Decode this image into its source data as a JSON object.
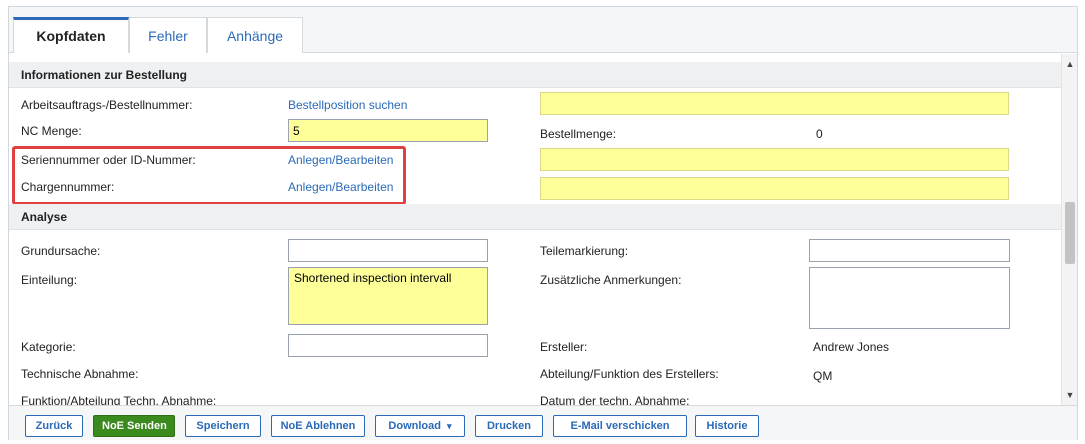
{
  "tabs": [
    {
      "label": "Kopfdaten",
      "active": true
    },
    {
      "label": "Fehler"
    },
    {
      "label": "Anhänge"
    }
  ],
  "sections": {
    "order_info": "Informationen zur Bestellung",
    "analysis": "Analyse"
  },
  "order": {
    "order_number_label": "Arbeitsauftrags-/Bestellnummer:",
    "order_number_link": "Bestellposition suchen",
    "nc_qty_label": "NC Menge:",
    "nc_qty_value": "5",
    "order_qty_label": "Bestellmenge:",
    "order_qty_value": "0",
    "serial_label": "Seriennummer oder ID-Nummer:",
    "serial_link": "Anlegen/Bearbeiten",
    "batch_label": "Chargennummer:",
    "batch_link": "Anlegen/Bearbeiten"
  },
  "analysis": {
    "root_cause_label": "Grundursache:",
    "root_cause_value": "",
    "part_marking_label": "Teilemarkierung:",
    "part_marking_value": "",
    "classification_label": "Einteilung:",
    "classification_value": "Shortened inspection intervall",
    "extra_notes_label": "Zusätzliche Anmerkungen:",
    "extra_notes_value": "",
    "category_label": "Kategorie:",
    "category_value": "",
    "creator_label": "Ersteller:",
    "creator_value": "Andrew Jones",
    "tech_approval_label": "Technische Abnahme:",
    "creator_dept_label": "Abteilung/Funktion des Erstellers:",
    "creator_dept_value": "QM",
    "tech_dept_label": "Funktion/Abteilung Techn. Abnahme:",
    "tech_date_label": "Datum der techn. Abnahme:"
  },
  "footer": {
    "back": "Zurück",
    "send": "NoE Senden",
    "save": "Speichern",
    "reject": "NoE Ablehnen",
    "download": "Download",
    "download_caret": "▾",
    "print": "Drucken",
    "email": "E-Mail verschicken",
    "history": "Historie"
  },
  "scrollbar": {
    "up_icon": "▲",
    "down_icon": "▼"
  },
  "colors": {
    "accent": "#2a6ab8",
    "primary_button": "#3b8a1e",
    "required_field": "#ffff99",
    "highlight": "#e04040"
  }
}
